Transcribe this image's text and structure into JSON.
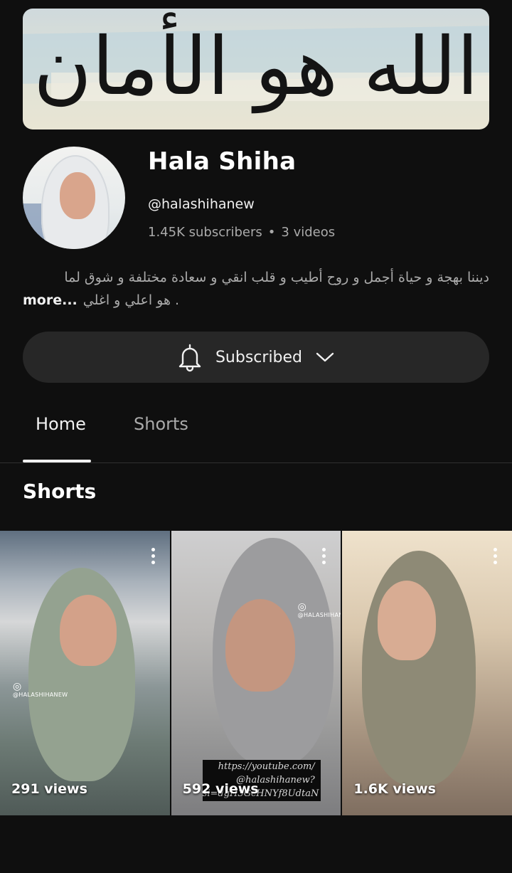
{
  "banner": {
    "calligraphy": "الله هو الأمان"
  },
  "channel": {
    "name": "Hala Shiha",
    "handle": "@halashihanew",
    "subscribers": "1.45K subscribers",
    "separator": "•",
    "videos": "3 videos",
    "description_line1": "ديننا بهجة و حياة أجمل و روح أطيب و قلب انقي و سعادة مختلفة و شوق لما",
    "description_line2": "هو اعلي و اغلي .",
    "more_label": "more..."
  },
  "subscribe_button": {
    "label": "Subscribed"
  },
  "tabs": [
    {
      "label": "Home",
      "active": true
    },
    {
      "label": "Shorts",
      "active": false
    }
  ],
  "section": {
    "title": "Shorts"
  },
  "shorts": [
    {
      "views": "291 views",
      "watermark": "@HALASHIHANEW"
    },
    {
      "views": "592 views",
      "watermark": "@HALASHIHANEW",
      "overlay": "https://youtube.com/ @halashihanew? si=dgH3GcHNYf8UdtaN"
    },
    {
      "views": "1.6K views"
    }
  ],
  "colors": {
    "background": "#0f0f0f",
    "button_bg": "#272727",
    "muted_text": "#aaaaaa"
  }
}
